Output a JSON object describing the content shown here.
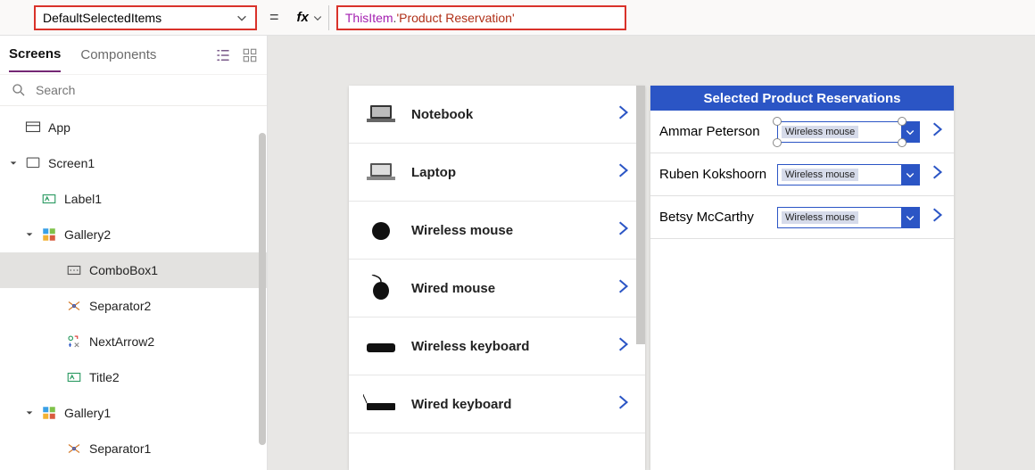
{
  "formula": {
    "property": "DefaultSelectedItems",
    "fx_label": "fx",
    "token_this": "ThisItem",
    "token_dot": ".",
    "token_string": "'Product Reservation'"
  },
  "tabs": {
    "screens": "Screens",
    "components": "Components"
  },
  "search": {
    "placeholder": "Search"
  },
  "tree": {
    "app": "App",
    "screen1": "Screen1",
    "label1": "Label1",
    "gallery2": "Gallery2",
    "combobox1": "ComboBox1",
    "separator2": "Separator2",
    "nextarrow2": "NextArrow2",
    "title2": "Title2",
    "gallery1": "Gallery1",
    "separator1": "Separator1"
  },
  "products": [
    {
      "label": "Notebook",
      "icon": "laptop"
    },
    {
      "label": "Laptop",
      "icon": "laptop"
    },
    {
      "label": "Wireless mouse",
      "icon": "mouse"
    },
    {
      "label": "Wired mouse",
      "icon": "mouse"
    },
    {
      "label": "Wireless keyboard",
      "icon": "keyboard"
    },
    {
      "label": "Wired keyboard",
      "icon": "keyboard"
    }
  ],
  "reservations": {
    "header": "Selected Product Reservations",
    "rows": [
      {
        "name": "Ammar Peterson",
        "combo_value": "Wireless mouse",
        "selected": true
      },
      {
        "name": "Ruben Kokshoorn",
        "combo_value": "Wireless mouse",
        "selected": false
      },
      {
        "name": "Betsy McCarthy",
        "combo_value": "Wireless mouse",
        "selected": false
      }
    ]
  },
  "colors": {
    "accent": "#2b55c5",
    "highlight_border": "#d9322a",
    "tab_underline": "#742774"
  }
}
